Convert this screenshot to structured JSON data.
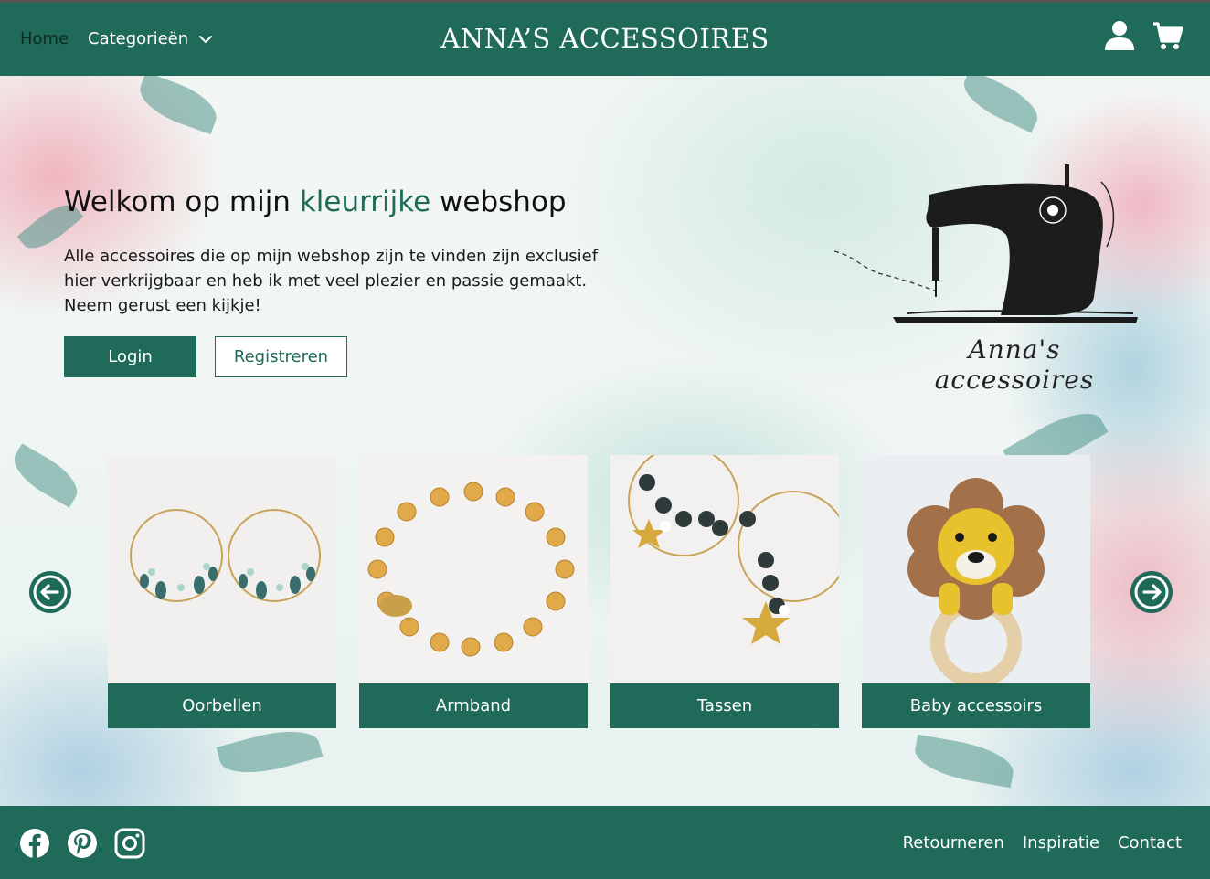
{
  "header": {
    "brand": "ANNA’S ACCESSOIRES",
    "nav": {
      "home": "Home",
      "categories": "Categorieën"
    },
    "icons": {
      "user": "user-icon",
      "cart": "cart-icon",
      "chevron": "chevron-down-icon"
    }
  },
  "hero": {
    "title_prefix": "Welkom op mijn ",
    "title_accent": "kleurrijke",
    "title_suffix": " webshop",
    "text": "Alle accessoires die op mijn webshop zijn te vinden zijn exclusief hier verkrijgbaar en heb ik met veel plezier en passie gemaakt. Neem gerust een kijkje!",
    "login_label": "Login",
    "register_label": "Registreren",
    "logo_text": "Anna's accessoires"
  },
  "carousel": {
    "items": [
      {
        "label": "Oorbellen"
      },
      {
        "label": "Armband"
      },
      {
        "label": "Tassen"
      },
      {
        "label": "Baby accessoirs"
      }
    ]
  },
  "footer": {
    "social": [
      "facebook-icon",
      "pinterest-icon",
      "instagram-icon"
    ],
    "links": [
      "Retourneren",
      "Inspiratie",
      "Contact"
    ]
  },
  "colors": {
    "brand_green": "#1f6a59",
    "white": "#ffffff"
  }
}
